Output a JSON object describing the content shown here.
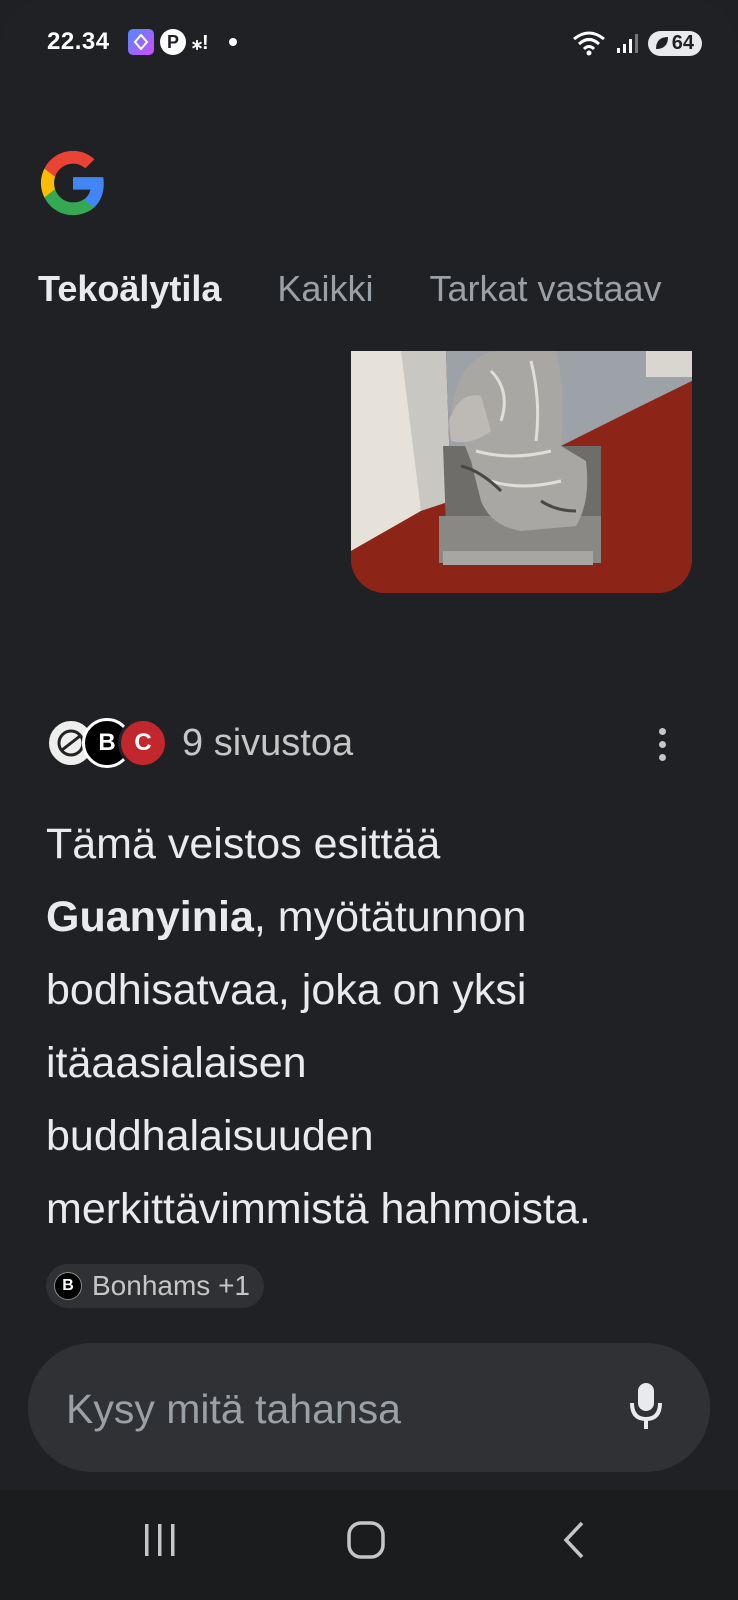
{
  "status_bar": {
    "time": "22.34",
    "battery": "64"
  },
  "tabs": [
    {
      "label": "Tekoälytila",
      "active": true
    },
    {
      "label": "Kaikki",
      "active": false
    },
    {
      "label": "Tarkat vastaav",
      "active": false
    }
  ],
  "sources": {
    "count_label": "9 sivustoa",
    "avatars": [
      "",
      "B",
      "C"
    ]
  },
  "answer": {
    "text_before": "Tämä veistos esittää ",
    "bold": "Guanyinia",
    "text_after": ", myötätunnon bodhisatvaa, joka on yksi itäaasialaisen buddhalaisuuden merkittävimmistä hahmoista.",
    "citation": {
      "badge": "B",
      "label": "Bonhams +1"
    }
  },
  "ask": {
    "placeholder": "Kysy mitä tahansa"
  },
  "icons": [
    "google-logo",
    "mic-icon",
    "more-vert-icon",
    "recents-icon",
    "home-icon",
    "back-icon"
  ]
}
